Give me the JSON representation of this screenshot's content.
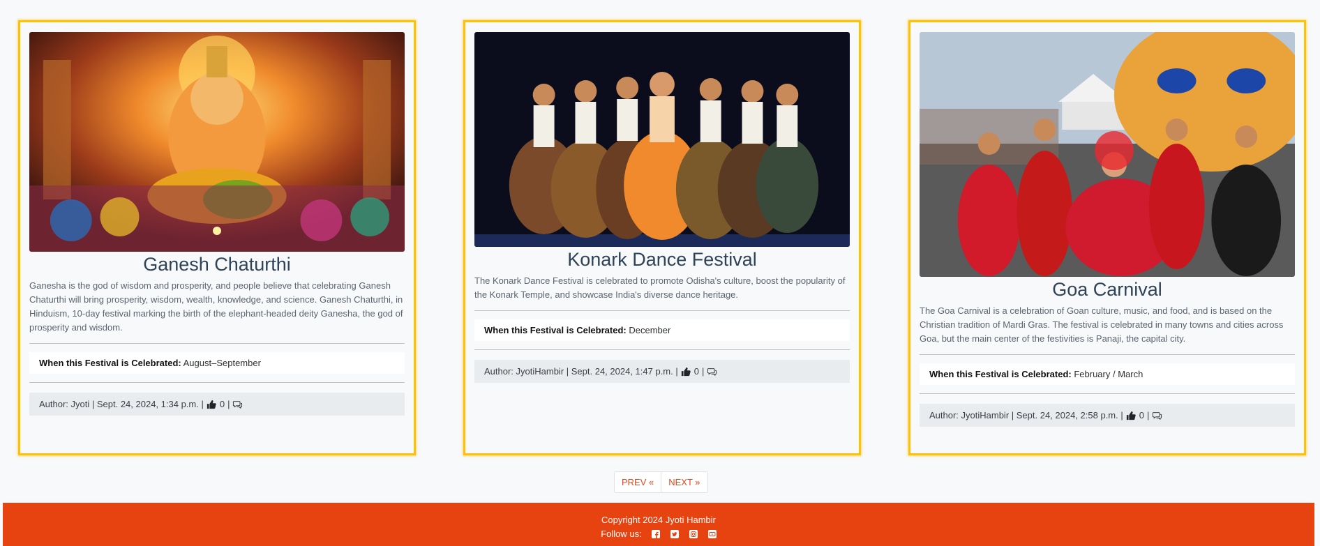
{
  "cards": [
    {
      "title": "Ganesh Chaturthi",
      "description": "Ganesha is the god of wisdom and prosperity, and people believe that celebrating Ganesh Chaturthi will bring prosperity, wisdom, wealth, knowledge, and science. Ganesh Chaturthi, in Hinduism, 10-day festival marking the birth of the elephant-headed deity Ganesha, the god of prosperity and wisdom.",
      "when_label": "When this Festival is Celebrated:",
      "when_value": "August–September",
      "meta": "Author: Jyoti | Sept. 24, 2024, 1:34 p.m. |",
      "likes": "0"
    },
    {
      "title": "Konark Dance Festival",
      "description": "The Konark Dance Festival is celebrated to promote Odisha's culture, boost the popularity of the Konark Temple, and showcase India's diverse dance heritage.",
      "when_label": "When this Festival is Celebrated:",
      "when_value": "December",
      "meta": "Author: JyotiHambir | Sept. 24, 2024, 1:47 p.m. |",
      "likes": "0"
    },
    {
      "title": "Goa Carnival",
      "description": "The Goa Carnival is a celebration of Goan culture, music, and food, and is based on the Christian tradition of Mardi Gras. The festival is celebrated in many towns and cities across Goa, but the main center of the festivities is Panaji, the capital city.",
      "when_label": "When this Festival is Celebrated:",
      "when_value": "February / March",
      "meta": "Author: JyotiHambir | Sept. 24, 2024, 2:58 p.m. |",
      "likes": "0"
    }
  ],
  "pagination": {
    "prev": "PREV «",
    "next": "NEXT »"
  },
  "footer": {
    "copyright": "Copyright 2024 Jyoti Hambir",
    "follow_label": "Follow us:",
    "social_icons": [
      "facebook-icon",
      "twitter-icon",
      "instagram-icon",
      "youtube-icon"
    ]
  },
  "colors": {
    "card_border": "#ffc107",
    "footer_bg": "#e64311",
    "pager_text": "#e8451a"
  }
}
